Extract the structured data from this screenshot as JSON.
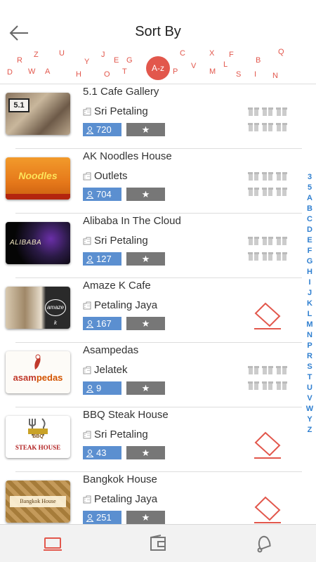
{
  "header": {
    "title": "Sort By"
  },
  "sort_cloud": {
    "letters": [
      "R",
      "Z",
      "U",
      "J",
      "E",
      "G",
      "C",
      "X",
      "F",
      "Q",
      "D",
      "W",
      "A",
      "Y",
      "H",
      "O",
      "T",
      "P",
      "V",
      "M",
      "L",
      "S",
      "B",
      "I",
      "N"
    ],
    "active": "A-z"
  },
  "restaurants": [
    {
      "name": "5.1 Cafe Gallery",
      "location": "Sri Petaling",
      "count": "720",
      "offer": "gifts"
    },
    {
      "name": "AK Noodles House",
      "location": "Outlets",
      "count": "704",
      "offer": "gifts"
    },
    {
      "name": "Alibaba In The Cloud",
      "location": "Sri Petaling",
      "count": "127",
      "offer": "gifts"
    },
    {
      "name": "Amaze K Cafe",
      "location": "Petaling Jaya",
      "count": "167",
      "offer": "coupon"
    },
    {
      "name": "Asampedas",
      "location": "Jelatek",
      "count": "9",
      "offer": "gifts"
    },
    {
      "name": "BBQ Steak House",
      "location": "Sri Petaling",
      "count": "43",
      "offer": "coupon"
    },
    {
      "name": "Bangkok House",
      "location": "Petaling Jaya",
      "count": "251",
      "offer": "coupon"
    }
  ],
  "thumbs": {
    "t0": "5.1",
    "t1": "Noodles",
    "t2": "ALIBABA",
    "t3": "amaze k",
    "t4a": "asam",
    "t4b": "pedas",
    "t5a": "BBQ",
    "t5b": "STEAK HOUSE",
    "t6": "Bangkok House"
  },
  "index_letters": [
    "3",
    "5",
    "A",
    "B",
    "C",
    "D",
    "E",
    "F",
    "G",
    "H",
    "I",
    "J",
    "K",
    "L",
    "M",
    "N",
    "P",
    "R",
    "S",
    "T",
    "U",
    "V",
    "W",
    "Y",
    "Z"
  ],
  "tabs": [
    "list-tab",
    "wallet-tab",
    "notifications-tab"
  ],
  "colors": {
    "accent": "#e2574c",
    "badge_blue": "#5b8fd0",
    "star_gray": "#777777",
    "index_blue": "#2f7fd0"
  }
}
